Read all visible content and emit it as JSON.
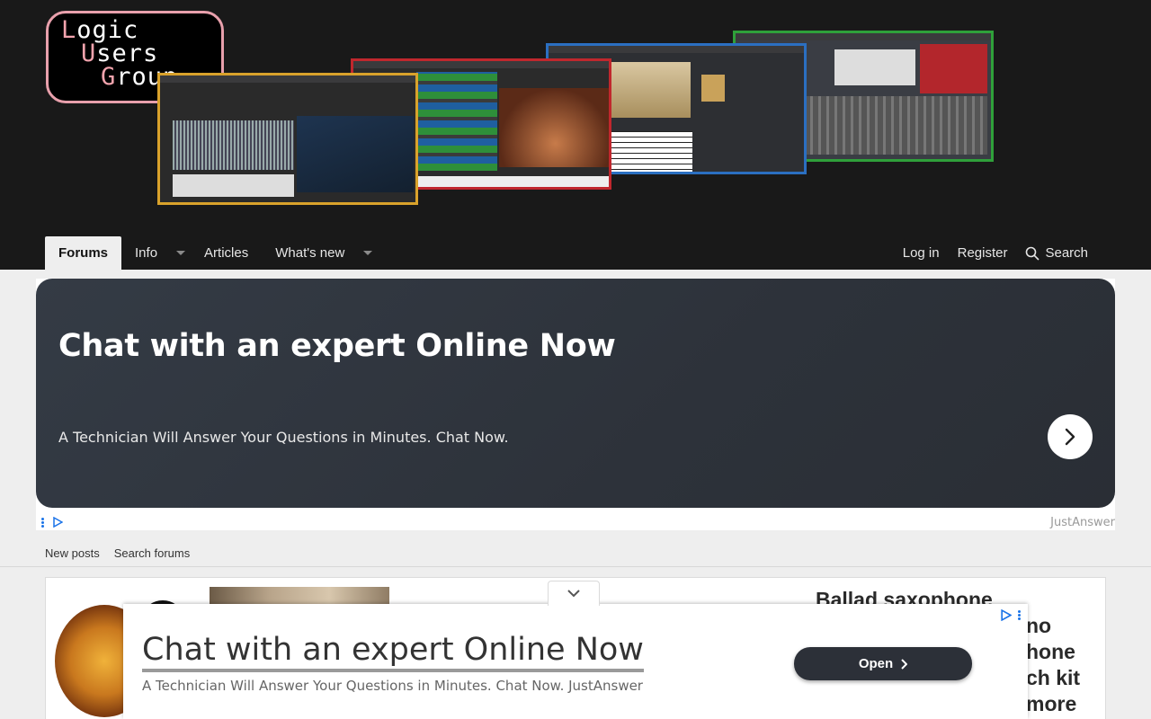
{
  "logo": {
    "line1_cap": "L",
    "line1_rest": "ogic",
    "line2_cap": "U",
    "line2_rest": "sers",
    "line3_cap": "G",
    "line3_rest": "roup"
  },
  "nav": {
    "left": [
      {
        "label": "Forums",
        "active": true,
        "has_menu": false
      },
      {
        "label": "Info",
        "active": false,
        "has_menu": true
      },
      {
        "label": "Articles",
        "active": false,
        "has_menu": false
      },
      {
        "label": "What's new",
        "active": false,
        "has_menu": true
      }
    ],
    "login": "Log in",
    "register": "Register",
    "search": "Search"
  },
  "ad_card": {
    "title": "Chat with an expert Online Now",
    "subtitle": "A Technician Will Answer Your Questions in Minutes. Chat Now.",
    "brand": "JustAnswer"
  },
  "subnav": {
    "new_posts": "New posts",
    "search_forums": "Search forums"
  },
  "content": {
    "side_text": [
      "Ballad saxophone",
      "no",
      "hone",
      "ch kit",
      "more"
    ]
  },
  "overlay_ad": {
    "title": "Chat with an expert Online Now",
    "subtitle": "A Technician Will Answer Your Questions in Minutes. Chat Now. JustAnswer",
    "button": "Open"
  },
  "colors": {
    "header_bg": "#191919",
    "logo_border": "#e8a0ac",
    "ad_card_bg": "#343b45",
    "open_button_bg": "#2c3038"
  }
}
